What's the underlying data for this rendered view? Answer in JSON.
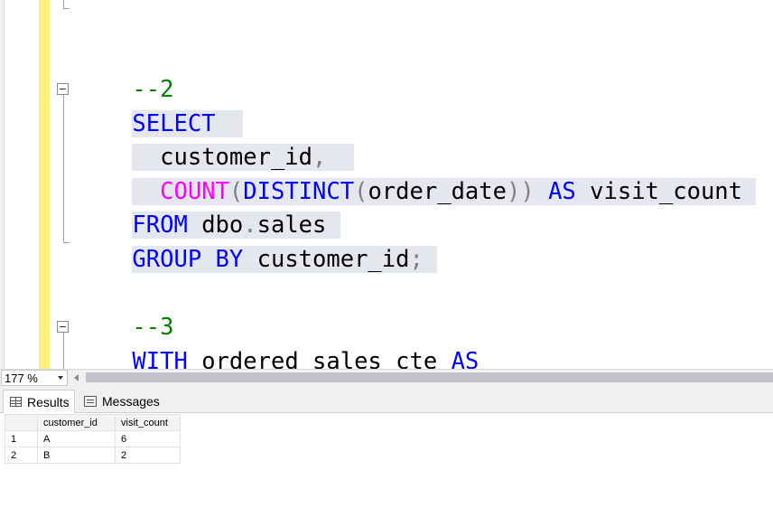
{
  "editor": {
    "lines": {
      "comment2": "--2",
      "select_kw": "SELECT",
      "customer_id_col": "customer_id",
      "comma": ",",
      "count_fn": "COUNT",
      "paren_open1": "(",
      "distinct_kw": "DISTINCT",
      "paren_open2": "(",
      "order_date_col": "order_date",
      "paren_close": "))",
      "as_kw": "AS",
      "visit_count_alias": "visit_count",
      "from_kw": "FROM",
      "table_schema": "dbo",
      "dot": ".",
      "table_name": "sales",
      "group_by_kw": "GROUP BY",
      "group_col": "customer_id",
      "semicolon": ";",
      "comment3": "--3",
      "with_kw": "WITH",
      "cte_name": "ordered_sales_cte",
      "as_kw2": "AS",
      "open_paren_line": "("
    }
  },
  "zoom": {
    "value": "177 %"
  },
  "results": {
    "tabs": [
      {
        "label": "Results",
        "icon": "grid-icon",
        "active": true
      },
      {
        "label": "Messages",
        "icon": "messages-icon",
        "active": false
      }
    ],
    "columns": [
      "customer_id",
      "visit_count"
    ],
    "rows": [
      {
        "num": "1",
        "customer_id": "A",
        "visit_count": "6"
      },
      {
        "num": "2",
        "customer_id": "B",
        "visit_count": "2"
      }
    ]
  },
  "colors": {
    "keyword": "#0000ff",
    "function": "#ff00ff",
    "comment": "#008000",
    "operator": "#808080",
    "selection": "#e4e8ee",
    "change_bar": "#fbf07a"
  }
}
